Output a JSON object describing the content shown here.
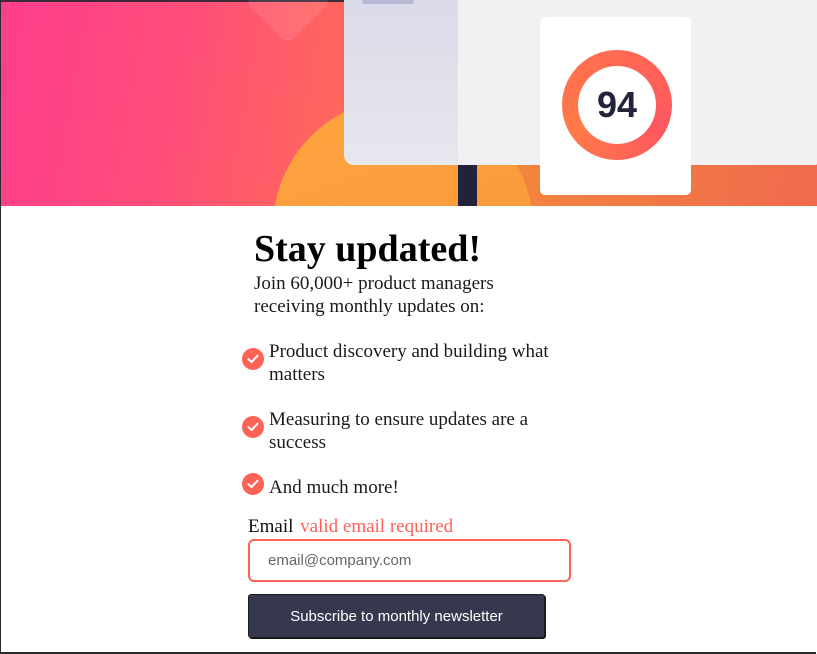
{
  "hero": {
    "score": "94",
    "colors": {
      "pink": "#ff3d8d",
      "orange": "#f48a3c",
      "coral": "#ff6257",
      "navy": "#23233a"
    }
  },
  "signup": {
    "title": "Stay updated!",
    "intro": "Join 60,000+ product managers receiving monthly updates on:",
    "features": [
      {
        "icon": "check-icon",
        "text": "Product discovery and building what matters"
      },
      {
        "icon": "check-icon",
        "text": "Measuring to ensure updates are a success"
      },
      {
        "icon": "check-icon",
        "text": "And much more!"
      }
    ],
    "email": {
      "label": "Email",
      "error": "valid email required",
      "placeholder": "email@company.com",
      "value": ""
    },
    "submit_label": "Subscribe to monthly newsletter"
  }
}
